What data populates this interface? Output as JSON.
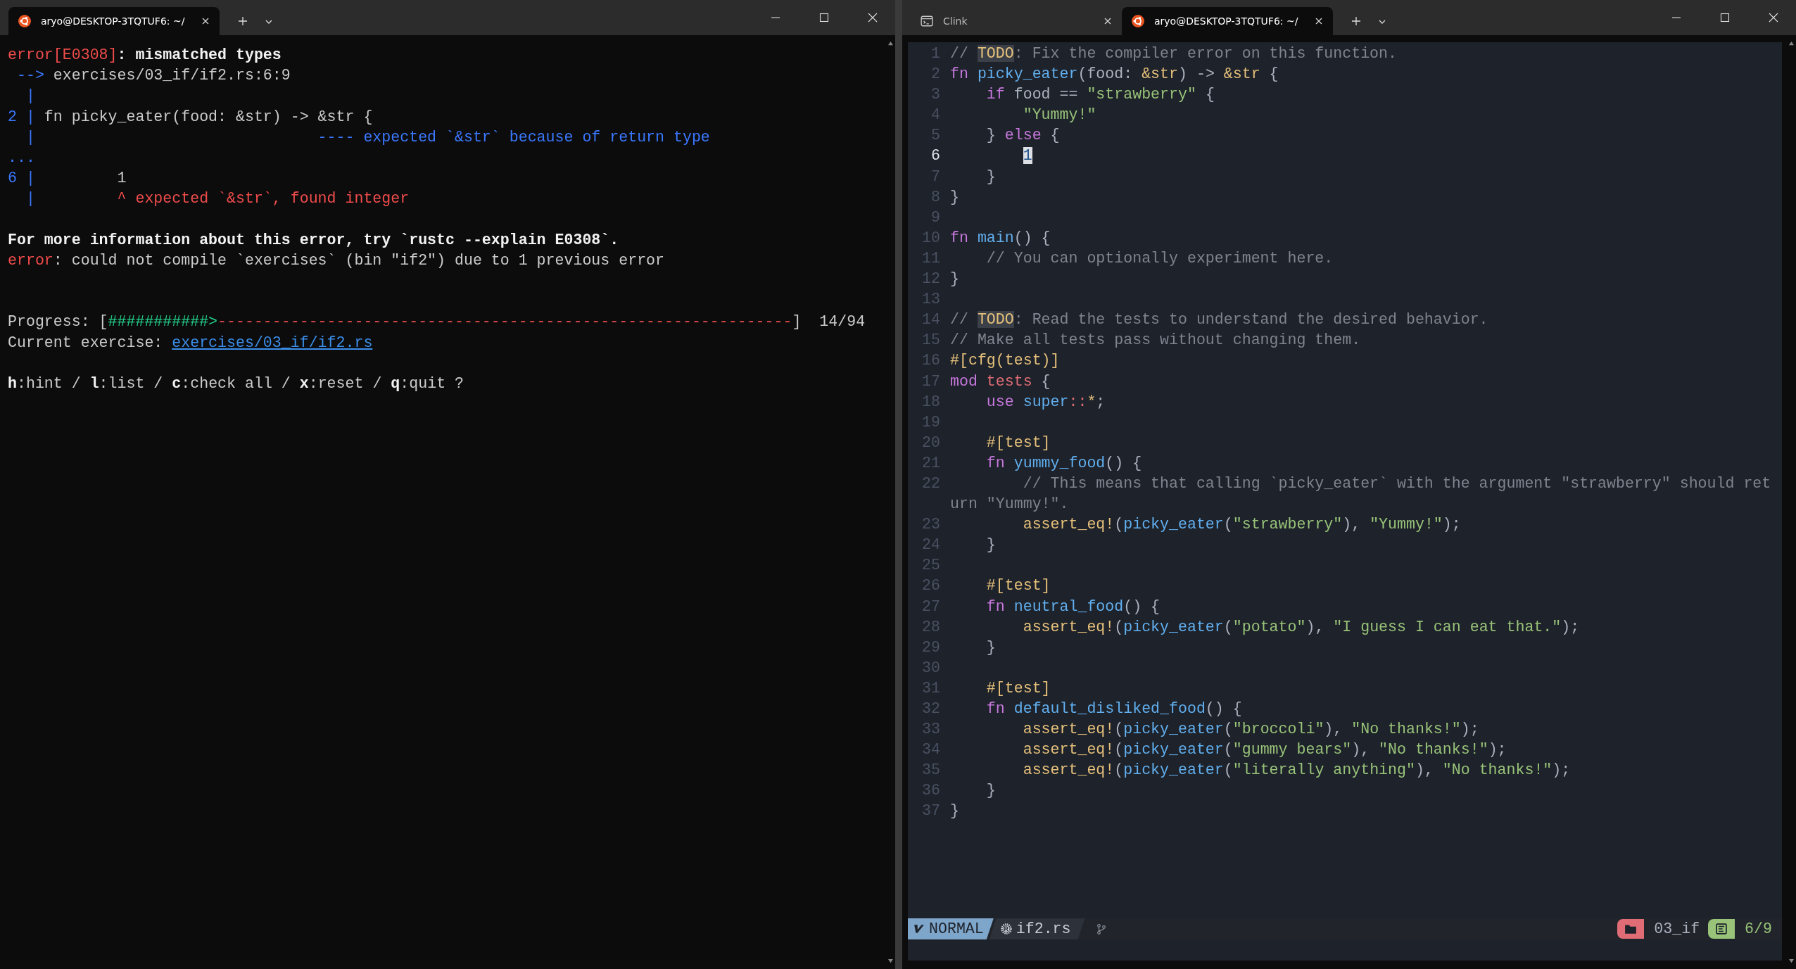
{
  "left_window": {
    "tabs": [
      {
        "title": "aryo@DESKTOP-3TQTUF6: ~/",
        "kind": "ubuntu",
        "selected": true
      }
    ],
    "terminal": [
      {
        "kind": "text",
        "segments": [
          {
            "text": "error[E0308]",
            "kind": "red"
          },
          {
            "text": ": mismatched types",
            "kind": "bold"
          }
        ]
      },
      {
        "kind": "text",
        "segments": [
          {
            "text": " -->",
            "kind": "blue"
          },
          {
            "text": " exercises/03_if/if2.rs:6:9",
            "kind": "plain"
          }
        ]
      },
      {
        "kind": "text",
        "segments": [
          {
            "text": "  |",
            "kind": "blue"
          }
        ]
      },
      {
        "kind": "text",
        "segments": [
          {
            "text": "2 |",
            "kind": "blue"
          },
          {
            "text": " fn picky_eater(food: &str) -> &str {",
            "kind": "plain"
          }
        ]
      },
      {
        "kind": "text",
        "segments": [
          {
            "text": "  |                               ---- expected `&str` because of return type",
            "kind": "blue"
          }
        ]
      },
      {
        "kind": "text",
        "segments": [
          {
            "text": "...",
            "kind": "blue"
          }
        ]
      },
      {
        "kind": "text",
        "segments": [
          {
            "text": "6 |",
            "kind": "blue"
          },
          {
            "text": "         1",
            "kind": "plain"
          }
        ]
      },
      {
        "kind": "text",
        "segments": [
          {
            "text": "  |",
            "kind": "blue"
          },
          {
            "text": "         ^ expected `&str`, found integer",
            "kind": "red"
          }
        ]
      },
      {
        "kind": "blank"
      },
      {
        "kind": "text",
        "segments": [
          {
            "text": "For more information about this error, try `rustc --explain E0308`.",
            "kind": "bold"
          }
        ]
      },
      {
        "kind": "text",
        "segments": [
          {
            "text": "error",
            "kind": "red"
          },
          {
            "text": ": could not compile `exercises` (bin \"if2\") due to 1 previous error",
            "kind": "plain"
          }
        ]
      },
      {
        "kind": "blank"
      },
      {
        "kind": "blank"
      },
      {
        "kind": "text",
        "segments": [
          {
            "text": "Progress: [",
            "kind": "plain"
          },
          {
            "text": "###########>",
            "kind": "green"
          },
          {
            "text": "---------------------------------------------------------------",
            "kind": "red"
          },
          {
            "text": "]  14/94",
            "kind": "plain"
          }
        ]
      },
      {
        "kind": "text",
        "segments": [
          {
            "text": "Current exercise: ",
            "kind": "plain"
          },
          {
            "text": "exercises/03_if/if2.rs",
            "kind": "link"
          }
        ]
      },
      {
        "kind": "blank"
      },
      {
        "kind": "text",
        "segments": [
          {
            "text": "h",
            "kind": "bold"
          },
          {
            "text": ":hint / ",
            "kind": "plain"
          },
          {
            "text": "l",
            "kind": "bold"
          },
          {
            "text": ":list / ",
            "kind": "plain"
          },
          {
            "text": "c",
            "kind": "bold"
          },
          {
            "text": ":check all / ",
            "kind": "plain"
          },
          {
            "text": "x",
            "kind": "bold"
          },
          {
            "text": ":reset / ",
            "kind": "plain"
          },
          {
            "text": "q",
            "kind": "bold"
          },
          {
            "text": ":quit ?",
            "kind": "plain"
          }
        ]
      }
    ]
  },
  "right_window": {
    "tabs": [
      {
        "title": "Clink",
        "kind": "cmd",
        "selected": false
      },
      {
        "title": "aryo@DESKTOP-3TQTUF6: ~/",
        "kind": "ubuntu",
        "selected": true
      }
    ],
    "editor": [
      {
        "number": "1",
        "current": false,
        "segments": [
          {
            "text": "// ",
            "kind": "comment"
          },
          {
            "text": "TODO",
            "kind": "todo"
          },
          {
            "text": ": Fix the compiler error on this function.",
            "kind": "comment"
          }
        ]
      },
      {
        "number": "2",
        "current": false,
        "segments": [
          {
            "text": "fn ",
            "kind": "keyword"
          },
          {
            "text": "picky_eater",
            "kind": "function"
          },
          {
            "text": "(food: ",
            "kind": "plain"
          },
          {
            "text": "&str",
            "kind": "type"
          },
          {
            "text": ") -> ",
            "kind": "plain"
          },
          {
            "text": "&str",
            "kind": "type"
          },
          {
            "text": " {",
            "kind": "plain"
          }
        ]
      },
      {
        "number": "3",
        "current": false,
        "segments": [
          {
            "text": "    if",
            "kind": "keyword"
          },
          {
            "text": " food == ",
            "kind": "plain"
          },
          {
            "text": "\"strawberry\"",
            "kind": "string"
          },
          {
            "text": " {",
            "kind": "plain"
          }
        ]
      },
      {
        "number": "4",
        "current": false,
        "segments": [
          {
            "text": "        \"Yummy!\"",
            "kind": "string"
          }
        ]
      },
      {
        "number": "5",
        "current": false,
        "segments": [
          {
            "text": "    } ",
            "kind": "plain"
          },
          {
            "text": "else",
            "kind": "keyword"
          },
          {
            "text": " {",
            "kind": "plain"
          }
        ]
      },
      {
        "number": "6",
        "current": true,
        "segments": [
          {
            "text": "        1",
            "kind": "cursor"
          }
        ]
      },
      {
        "number": "7",
        "current": false,
        "segments": [
          {
            "text": "    }",
            "kind": "plain"
          }
        ]
      },
      {
        "number": "8",
        "current": false,
        "segments": [
          {
            "text": "}",
            "kind": "plain"
          }
        ]
      },
      {
        "number": "9",
        "current": false
      },
      {
        "number": "10",
        "current": false,
        "segments": [
          {
            "text": "fn ",
            "kind": "keyword"
          },
          {
            "text": "main",
            "kind": "function"
          },
          {
            "text": "() {",
            "kind": "plain"
          }
        ]
      },
      {
        "number": "11",
        "current": false,
        "segments": [
          {
            "text": "    // You can optionally experiment here.",
            "kind": "comment"
          }
        ]
      },
      {
        "number": "12",
        "current": false,
        "segments": [
          {
            "text": "}",
            "kind": "plain"
          }
        ]
      },
      {
        "number": "13",
        "current": false
      },
      {
        "number": "14",
        "current": false,
        "segments": [
          {
            "text": "// ",
            "kind": "comment"
          },
          {
            "text": "TODO",
            "kind": "todo"
          },
          {
            "text": ": Read the tests to understand the desired behavior.",
            "kind": "comment"
          }
        ]
      },
      {
        "number": "15",
        "current": false,
        "segments": [
          {
            "text": "// Make all tests pass without changing them.",
            "kind": "comment"
          }
        ]
      },
      {
        "number": "16",
        "current": false,
        "segments": [
          {
            "text": "#[cfg(test)]",
            "kind": "attribute"
          }
        ]
      },
      {
        "number": "17",
        "current": false,
        "segments": [
          {
            "text": "mod ",
            "kind": "keyword"
          },
          {
            "text": "tests",
            "kind": "module"
          },
          {
            "text": " {",
            "kind": "plain"
          }
        ]
      },
      {
        "number": "18",
        "current": false,
        "segments": [
          {
            "text": "    use ",
            "kind": "keyword"
          },
          {
            "text": "super",
            "kind": "function"
          },
          {
            "text": "::",
            "kind": "module"
          },
          {
            "text": "*",
            "kind": "type"
          },
          {
            "text": ";",
            "kind": "plain"
          }
        ]
      },
      {
        "number": "19",
        "current": false
      },
      {
        "number": "20",
        "current": false,
        "segments": [
          {
            "text": "    #[test]",
            "kind": "attribute"
          }
        ]
      },
      {
        "number": "21",
        "current": false,
        "segments": [
          {
            "text": "    fn ",
            "kind": "keyword"
          },
          {
            "text": "yummy_food",
            "kind": "function"
          },
          {
            "text": "() {",
            "kind": "plain"
          }
        ]
      },
      {
        "number": "22",
        "current": false,
        "segments": [
          {
            "text": "        // This means that calling `picky_eater` with the argument \"strawberry\" should ret",
            "kind": "comment"
          }
        ],
        "wrap_segments": [
          {
            "text": "urn \"Yummy!\".",
            "kind": "comment"
          }
        ]
      },
      {
        "number": "23",
        "current": false,
        "segments": [
          {
            "text": "        assert_eq!",
            "kind": "macro"
          },
          {
            "text": "(",
            "kind": "plain"
          },
          {
            "text": "picky_eater",
            "kind": "function"
          },
          {
            "text": "(",
            "kind": "plain"
          },
          {
            "text": "\"strawberry\"",
            "kind": "string"
          },
          {
            "text": "), ",
            "kind": "plain"
          },
          {
            "text": "\"Yummy!\"",
            "kind": "string"
          },
          {
            "text": ");",
            "kind": "plain"
          }
        ]
      },
      {
        "number": "24",
        "current": false,
        "segments": [
          {
            "text": "    }",
            "kind": "plain"
          }
        ]
      },
      {
        "number": "25",
        "current": false
      },
      {
        "number": "26",
        "current": false,
        "segments": [
          {
            "text": "    #[test]",
            "kind": "attribute"
          }
        ]
      },
      {
        "number": "27",
        "current": false,
        "segments": [
          {
            "text": "    fn ",
            "kind": "keyword"
          },
          {
            "text": "neutral_food",
            "kind": "function"
          },
          {
            "text": "() {",
            "kind": "plain"
          }
        ]
      },
      {
        "number": "28",
        "current": false,
        "segments": [
          {
            "text": "        assert_eq!",
            "kind": "macro"
          },
          {
            "text": "(",
            "kind": "plain"
          },
          {
            "text": "picky_eater",
            "kind": "function"
          },
          {
            "text": "(",
            "kind": "plain"
          },
          {
            "text": "\"potato\"",
            "kind": "string"
          },
          {
            "text": "), ",
            "kind": "plain"
          },
          {
            "text": "\"I guess I can eat that.\"",
            "kind": "string"
          },
          {
            "text": ");",
            "kind": "plain"
          }
        ]
      },
      {
        "number": "29",
        "current": false,
        "segments": [
          {
            "text": "    }",
            "kind": "plain"
          }
        ]
      },
      {
        "number": "30",
        "current": false
      },
      {
        "number": "31",
        "current": false,
        "segments": [
          {
            "text": "    #[test]",
            "kind": "attribute"
          }
        ]
      },
      {
        "number": "32",
        "current": false,
        "segments": [
          {
            "text": "    fn ",
            "kind": "keyword"
          },
          {
            "text": "default_disliked_food",
            "kind": "function"
          },
          {
            "text": "() {",
            "kind": "plain"
          }
        ]
      },
      {
        "number": "33",
        "current": false,
        "segments": [
          {
            "text": "        assert_eq!",
            "kind": "macro"
          },
          {
            "text": "(",
            "kind": "plain"
          },
          {
            "text": "picky_eater",
            "kind": "function"
          },
          {
            "text": "(",
            "kind": "plain"
          },
          {
            "text": "\"broccoli\"",
            "kind": "string"
          },
          {
            "text": "), ",
            "kind": "plain"
          },
          {
            "text": "\"No thanks!\"",
            "kind": "string"
          },
          {
            "text": ");",
            "kind": "plain"
          }
        ]
      },
      {
        "number": "34",
        "current": false,
        "segments": [
          {
            "text": "        assert_eq!",
            "kind": "macro"
          },
          {
            "text": "(",
            "kind": "plain"
          },
          {
            "text": "picky_eater",
            "kind": "function"
          },
          {
            "text": "(",
            "kind": "plain"
          },
          {
            "text": "\"gummy bears\"",
            "kind": "string"
          },
          {
            "text": "), ",
            "kind": "plain"
          },
          {
            "text": "\"No thanks!\"",
            "kind": "string"
          },
          {
            "text": ");",
            "kind": "plain"
          }
        ]
      },
      {
        "number": "35",
        "current": false,
        "segments": [
          {
            "text": "        assert_eq!",
            "kind": "macro"
          },
          {
            "text": "(",
            "kind": "plain"
          },
          {
            "text": "picky_eater",
            "kind": "function"
          },
          {
            "text": "(",
            "kind": "plain"
          },
          {
            "text": "\"literally anything\"",
            "kind": "string"
          },
          {
            "text": "), ",
            "kind": "plain"
          },
          {
            "text": "\"No thanks!\"",
            "kind": "string"
          },
          {
            "text": ");",
            "kind": "plain"
          }
        ]
      },
      {
        "number": "36",
        "current": false,
        "segments": [
          {
            "text": "    }",
            "kind": "plain"
          }
        ]
      },
      {
        "number": "37",
        "current": false,
        "segments": [
          {
            "text": "}",
            "kind": "plain"
          }
        ]
      }
    ],
    "status_bar": {
      "mode": "NORMAL",
      "file": "if2.rs",
      "directory": "03_if",
      "position": "6/9"
    }
  }
}
